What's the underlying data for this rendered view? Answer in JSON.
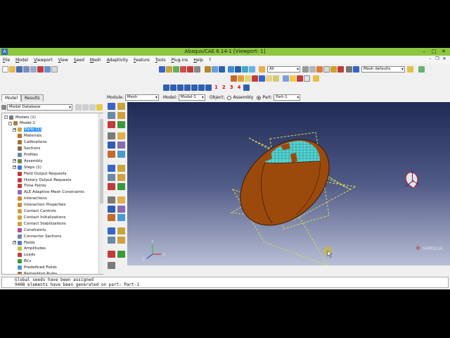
{
  "window": {
    "title": "Abaqus/CAE 6.14-1 [Viewport: 1]"
  },
  "menu": [
    "File",
    "Model",
    "Viewport",
    "View",
    "Seed",
    "Mesh",
    "Adaptivity",
    "Feature",
    "Tools",
    "Plug-ins",
    "Help",
    "?"
  ],
  "toolbar": {
    "selection_filter": "All",
    "render_style": "Mesh defaults",
    "view_numbers": [
      "1",
      "2",
      "3",
      "4"
    ]
  },
  "context": {
    "module_label": "Module:",
    "module_value": "Mesh",
    "model_label": "Model:",
    "model_value": "Model-1",
    "object_label": "Object:",
    "assembly_label": "Assembly",
    "part_label": "Part:",
    "part_value": "Part-1"
  },
  "tabs": [
    "Model",
    "Results"
  ],
  "model_database": "Model Database",
  "tree": [
    {
      "label": "Models (1)",
      "level": 0,
      "exp": "-"
    },
    {
      "label": "Model-1",
      "level": 1,
      "exp": "-"
    },
    {
      "label": "Parts (1)",
      "level": 2,
      "exp": "+",
      "selected": true
    },
    {
      "label": "Materials",
      "level": 2,
      "exp": ""
    },
    {
      "label": "Calibrations",
      "level": 2,
      "exp": ""
    },
    {
      "label": "Sections",
      "level": 2,
      "exp": ""
    },
    {
      "label": "Profiles",
      "level": 2,
      "exp": ""
    },
    {
      "label": "Assembly",
      "level": 2,
      "exp": "+"
    },
    {
      "label": "Steps (1)",
      "level": 2,
      "exp": "+"
    },
    {
      "label": "Field Output Requests",
      "level": 2,
      "exp": ""
    },
    {
      "label": "History Output Requests",
      "level": 2,
      "exp": ""
    },
    {
      "label": "Time Points",
      "level": 2,
      "exp": ""
    },
    {
      "label": "ALE Adaptive Mesh Constraints",
      "level": 2,
      "exp": ""
    },
    {
      "label": "Interactions",
      "level": 2,
      "exp": ""
    },
    {
      "label": "Interaction Properties",
      "level": 2,
      "exp": ""
    },
    {
      "label": "Contact Controls",
      "level": 2,
      "exp": ""
    },
    {
      "label": "Contact Initializations",
      "level": 2,
      "exp": ""
    },
    {
      "label": "Contact Stabilizations",
      "level": 2,
      "exp": ""
    },
    {
      "label": "Constraints",
      "level": 2,
      "exp": ""
    },
    {
      "label": "Connector Sections",
      "level": 2,
      "exp": ""
    },
    {
      "label": "Fields",
      "level": 2,
      "exp": "+"
    },
    {
      "label": "Amplitudes",
      "level": 2,
      "exp": ""
    },
    {
      "label": "Loads",
      "level": 2,
      "exp": ""
    },
    {
      "label": "BCs",
      "level": 2,
      "exp": ""
    },
    {
      "label": "Predefined Fields",
      "level": 2,
      "exp": ""
    },
    {
      "label": "Remeshing Rules",
      "level": 2,
      "exp": ""
    }
  ],
  "viewport": {
    "triad": {
      "x": "X",
      "y": "Y",
      "z": "Z"
    },
    "brand": "SIMULIA",
    "colors": {
      "part": "#9c4a0c",
      "mesh": "#55d6d6",
      "partition": "#d9d95a"
    }
  },
  "messages": [
    "Global seeds have been assigned",
    "9408 elements have been generated on part: Part-1"
  ]
}
